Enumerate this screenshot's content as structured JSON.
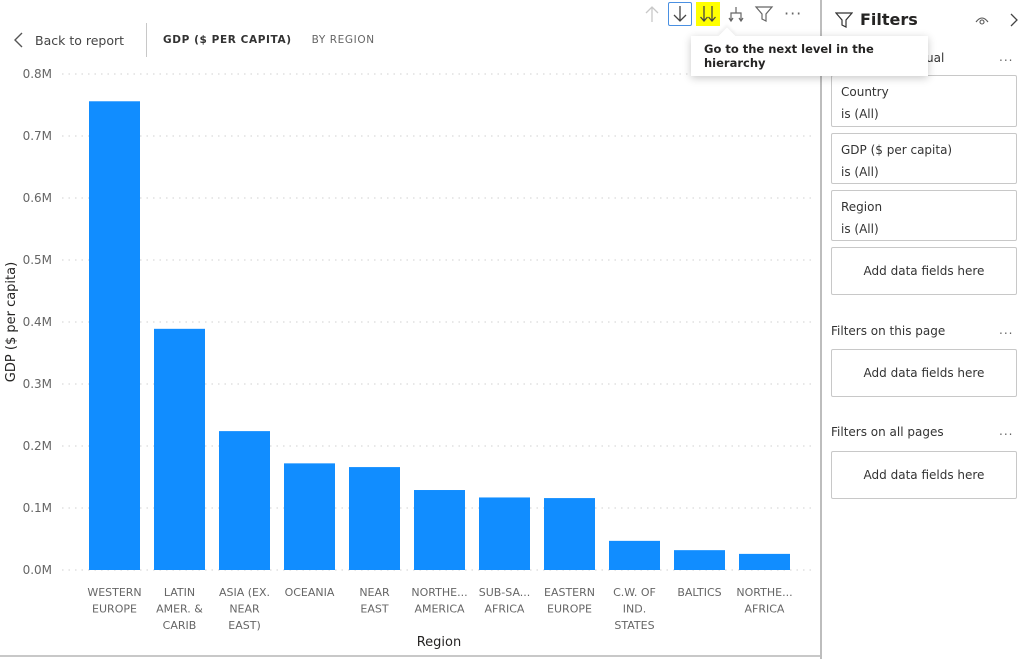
{
  "nav": {
    "back_label": "Back to report",
    "breadcrumb_main": "GDP ($ PER CAPITA)",
    "breadcrumb_sub": "BY REGION"
  },
  "toolbar": {
    "buttons": [
      {
        "name": "drill-up",
        "icon": "arrow-up-icon",
        "state": "disabled"
      },
      {
        "name": "drill-mode",
        "icon": "arrow-down-icon",
        "state": "selected"
      },
      {
        "name": "next-level",
        "icon": "double-arrow-down-icon",
        "state": "highlighted"
      },
      {
        "name": "expand-hierarchy",
        "icon": "fork-down-icon",
        "state": "normal"
      },
      {
        "name": "filter",
        "icon": "filter-icon",
        "state": "normal"
      }
    ],
    "more_label": "···",
    "tooltip": "Go to the next level in the hierarchy"
  },
  "chart_data": {
    "type": "bar",
    "title": "",
    "xlabel": "Region",
    "ylabel": "GDP ($ per capita)",
    "ylim": [
      0,
      800000
    ],
    "yticks": [
      0,
      100000,
      200000,
      300000,
      400000,
      500000,
      600000,
      700000,
      800000
    ],
    "ytick_labels": [
      "0.0M",
      "0.1M",
      "0.2M",
      "0.3M",
      "0.4M",
      "0.5M",
      "0.6M",
      "0.7M",
      "0.8M"
    ],
    "grid": true,
    "color": "#118DFF",
    "categories": [
      [
        "WESTERN",
        "EUROPE"
      ],
      [
        "LATIN",
        "AMER. &",
        "CARIB"
      ],
      [
        "ASIA (EX.",
        "NEAR",
        "EAST)"
      ],
      [
        "OCEANIA"
      ],
      [
        "NEAR",
        "EAST"
      ],
      [
        "NORTHE...",
        "AMERICA"
      ],
      [
        "SUB-SA...",
        "AFRICA"
      ],
      [
        "EASTERN",
        "EUROPE"
      ],
      [
        "C.W. OF",
        "IND.",
        "STATES"
      ],
      [
        "BALTICS"
      ],
      [
        "NORTHE...",
        "AFRICA"
      ]
    ],
    "values": [
      756000,
      389000,
      224000,
      172000,
      166000,
      129000,
      117000,
      116000,
      47000,
      32000,
      26000
    ]
  },
  "filters": {
    "title": "Filters",
    "visual_section": "Filters on this visual",
    "visual_section_visible": "ual",
    "visual_filters": [
      {
        "name": "Country",
        "value": "is (All)"
      },
      {
        "name": "GDP ($ per capita)",
        "value": "is (All)"
      },
      {
        "name": "Region",
        "value": "is (All)"
      }
    ],
    "add_fields": "Add data fields here",
    "page_section": "Filters on this page",
    "all_pages_section": "Filters on all pages",
    "more_label": "..."
  }
}
